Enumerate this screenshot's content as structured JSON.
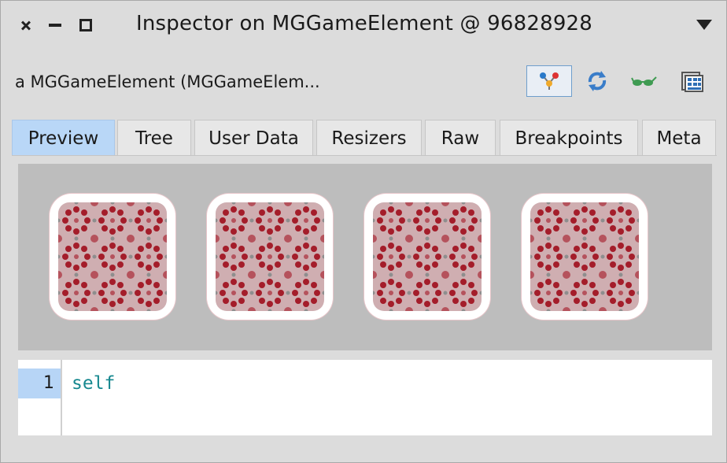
{
  "window": {
    "title": "Inspector on MGGameElement @ 96828928"
  },
  "header": {
    "object_title": "a MGGameElement (MGGameElem..."
  },
  "toolbar": {
    "icons": [
      "explore-graph-icon",
      "refresh-icon",
      "glasses-icon",
      "browse-table-icon"
    ]
  },
  "tabs": [
    {
      "label": "Preview",
      "active": true
    },
    {
      "label": "Tree"
    },
    {
      "label": "User Data"
    },
    {
      "label": "Resizers"
    },
    {
      "label": "Raw"
    },
    {
      "label": "Breakpoints"
    },
    {
      "label": "Meta"
    }
  ],
  "preview": {
    "tile_count": 4
  },
  "code": {
    "lines": [
      {
        "number": "1",
        "text": "self"
      }
    ]
  },
  "colors": {
    "pattern_dark": "#a41d2a",
    "pattern_mid": "#b5525c",
    "pattern_light": "#c9a3a6",
    "tab_active": "#b9d7f7",
    "code_selector": "#17888f"
  }
}
